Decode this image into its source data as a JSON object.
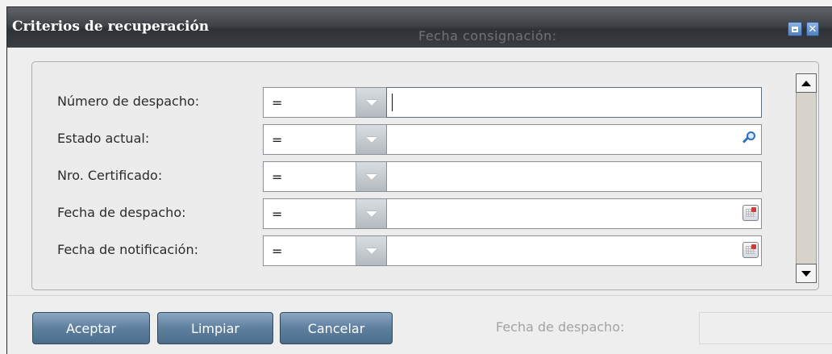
{
  "window": {
    "title": "Criterios de recuperación",
    "background_header_text": "Fecha consignación:",
    "maximize_icon": "maximize-icon",
    "close_icon": "close-icon"
  },
  "criteria": [
    {
      "label": "Número de despacho:",
      "operator": "=",
      "value": "",
      "trigger_icon": null,
      "focused": true
    },
    {
      "label": "Estado actual:",
      "operator": "=",
      "value": "",
      "trigger_icon": "search-icon"
    },
    {
      "label": "Nro. Certificado:",
      "operator": "=",
      "value": "",
      "trigger_icon": null
    },
    {
      "label": "Fecha de despacho:",
      "operator": "=",
      "value": "",
      "trigger_icon": "calendar-icon"
    },
    {
      "label": "Fecha de notificación:",
      "operator": "=",
      "value": "",
      "trigger_icon": "calendar-icon"
    }
  ],
  "buttons": {
    "accept": "Aceptar",
    "clear": "Limpiar",
    "cancel": "Cancelar"
  },
  "background": {
    "label": "Fecha de despacho:"
  },
  "colors": {
    "title_bar": "#3a3e42",
    "button": "#5f7f9f",
    "window_icon": "#4f7fbf"
  }
}
